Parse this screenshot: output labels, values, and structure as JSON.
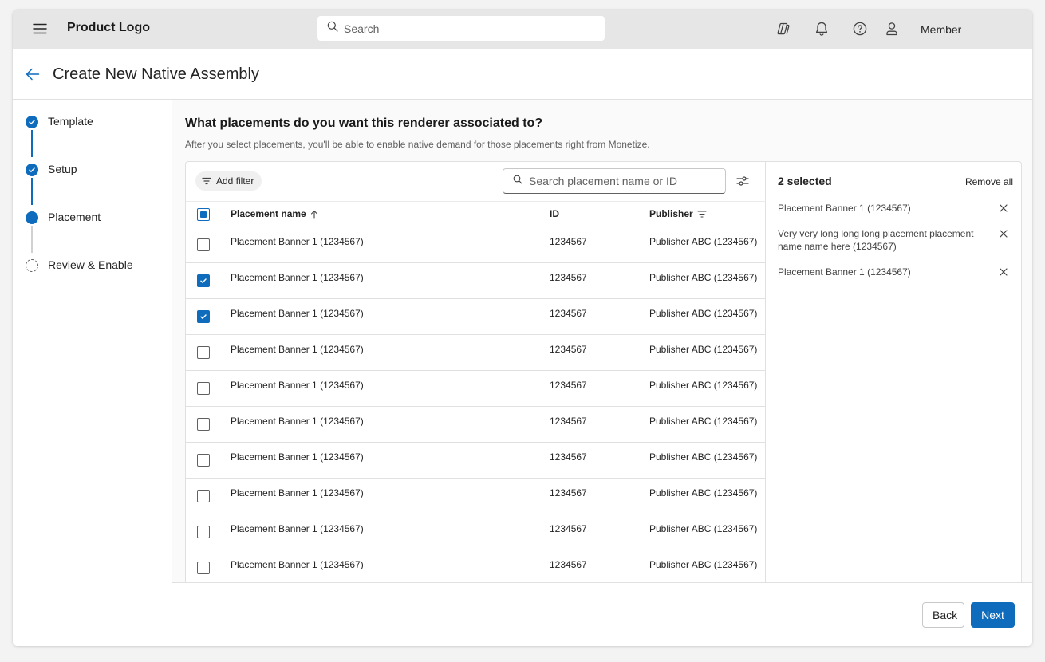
{
  "topbar": {
    "product_logo": "Product Logo",
    "search_placeholder": "Search",
    "member_label": "Member",
    "icons": [
      "menu-icon",
      "copilot-icon",
      "bell-icon",
      "help-icon",
      "person-icon"
    ]
  },
  "page": {
    "title": "Create New Native Assembly"
  },
  "stepper": {
    "steps": [
      {
        "label": "Template",
        "status": "done"
      },
      {
        "label": "Setup",
        "status": "done"
      },
      {
        "label": "Placement",
        "status": "current"
      },
      {
        "label": "Review & Enable",
        "status": "pending"
      }
    ]
  },
  "placements": {
    "question": "What placements do you want this renderer associated to?",
    "description": "After you select placements, you'll be able to enable native demand for those placements right from Monetize.",
    "add_filter_label": "Add filter",
    "search_placeholder": "Search placement name or ID",
    "columns": {
      "name": "Placement name",
      "id": "ID",
      "publisher": "Publisher"
    },
    "rows": [
      {
        "name": "Placement Banner 1 (1234567)",
        "id": "1234567",
        "publisher": "Publisher ABC (1234567)",
        "checked": false
      },
      {
        "name": "Placement Banner 1 (1234567)",
        "id": "1234567",
        "publisher": "Publisher ABC (1234567)",
        "checked": true
      },
      {
        "name": "Placement Banner 1 (1234567)",
        "id": "1234567",
        "publisher": "Publisher ABC (1234567)",
        "checked": true
      },
      {
        "name": "Placement Banner 1 (1234567)",
        "id": "1234567",
        "publisher": "Publisher ABC (1234567)",
        "checked": false
      },
      {
        "name": "Placement Banner 1 (1234567)",
        "id": "1234567",
        "publisher": "Publisher ABC (1234567)",
        "checked": false
      },
      {
        "name": "Placement Banner 1 (1234567)",
        "id": "1234567",
        "publisher": "Publisher ABC (1234567)",
        "checked": false
      },
      {
        "name": "Placement Banner 1 (1234567)",
        "id": "1234567",
        "publisher": "Publisher ABC (1234567)",
        "checked": false
      },
      {
        "name": "Placement Banner 1 (1234567)",
        "id": "1234567",
        "publisher": "Publisher ABC (1234567)",
        "checked": false
      },
      {
        "name": "Placement Banner 1 (1234567)",
        "id": "1234567",
        "publisher": "Publisher ABC (1234567)",
        "checked": false
      },
      {
        "name": "Placement Banner 1 (1234567)",
        "id": "1234567",
        "publisher": "Publisher ABC (1234567)",
        "checked": false
      }
    ]
  },
  "selection": {
    "count_label": "2 selected",
    "remove_all_label": "Remove all",
    "items": [
      {
        "label": "Placement Banner 1 (1234567)"
      },
      {
        "label": "Very very long long long placement placement name name here (1234567)"
      },
      {
        "label": "Placement Banner 1 (1234567)"
      }
    ]
  },
  "footer": {
    "back_label": "Back",
    "next_label": "Next"
  },
  "colors": {
    "accent": "#0f6cbd",
    "topbar_bg": "#e6e6e6"
  }
}
